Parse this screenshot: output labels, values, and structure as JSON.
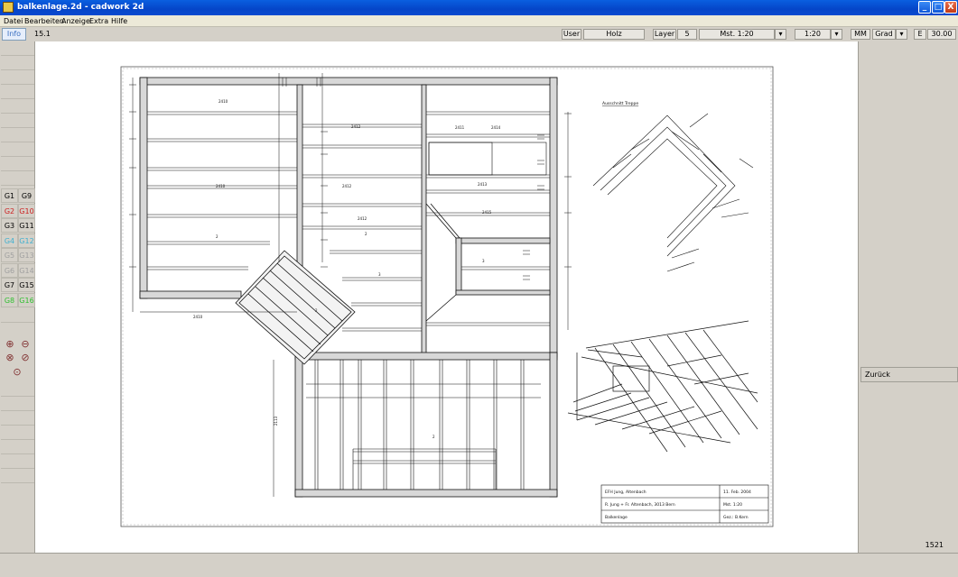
{
  "window": {
    "title": "balkenlage.2d - cadwork 2d",
    "buttons": {
      "minimize": "_",
      "maximize": "□",
      "close": "X"
    }
  },
  "menu": [
    "Datei",
    "Bearbeiten",
    "Anzeige",
    "Extra",
    "Hilfe"
  ],
  "toolbar": {
    "info_label": "Info",
    "version": "15.1",
    "user_label": "User",
    "user_value": "Holz",
    "layer_label": "Layer",
    "layer_value": "5",
    "scale_label": "Mst. 1:20",
    "scale_value": "1:20",
    "unit_value": "MM",
    "angle_value": "Grad",
    "e_label": "E",
    "e_value": "30.00"
  },
  "groups": [
    {
      "left": "G1",
      "right": "G9",
      "left_color": "#000000",
      "right_color": "#000000"
    },
    {
      "left": "G2",
      "right": "G10",
      "left_color": "#cc2020",
      "right_color": "#cc2020"
    },
    {
      "left": "G3",
      "right": "G11",
      "left_color": "#000000",
      "right_color": "#000000"
    },
    {
      "left": "G4",
      "right": "G12",
      "left_color": "#40b0d0",
      "right_color": "#40b0d0"
    },
    {
      "left": "G5",
      "right": "G13",
      "left_color": "#a0a0a0",
      "right_color": "#a0a0a0"
    },
    {
      "left": "G6",
      "right": "G14",
      "left_color": "#a0a0a0",
      "right_color": "#a0a0a0"
    },
    {
      "left": "G7",
      "right": "G15",
      "left_color": "#000000",
      "right_color": "#000000"
    },
    {
      "left": "G8",
      "right": "G16",
      "left_color": "#30c030",
      "right_color": "#30c030"
    }
  ],
  "zoom_icons": [
    "zoom-in-icon",
    "zoom-out-icon",
    "zoom-window-icon",
    "zoom-previous-icon",
    "zoom-all-icon"
  ],
  "right_panel": {
    "back_label": "Zurück",
    "coordinate": "1521"
  },
  "drawing": {
    "detail_heading": "Ausschnitt Treppe",
    "title_block": [
      [
        "EFH Jung, Altenbach",
        "11. Feb. 2004"
      ],
      [
        "R. Jung + Fr. Altenbach, 3013 Bern",
        "Mst. 1:20"
      ],
      [
        "Balkenlage",
        "Gez.: B.Kern"
      ]
    ]
  }
}
